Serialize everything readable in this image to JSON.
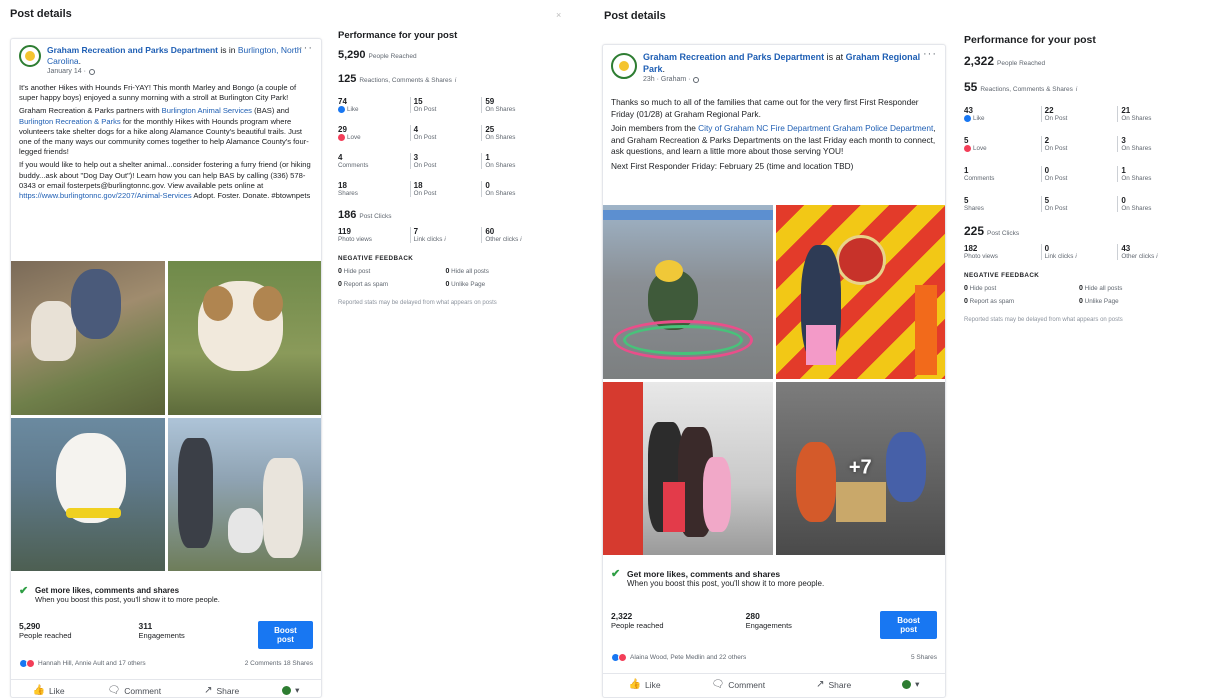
{
  "left": {
    "panel_title": "Post details",
    "close_label": "×",
    "post": {
      "page_name": "Graham Recreation and Parks Department",
      "is_in": " is in ",
      "location": "Burlington, North Carolina",
      "location_suffix": ".",
      "date": "January 14 ·",
      "more": "···",
      "p1": "It's another Hikes with Hounds Fri-YAY! This month Marley and Bongo (a couple of super happy boys) enjoyed a sunny morning with a stroll at Burlington City Park!",
      "p2_a": "Graham Recreation & Parks partners with ",
      "p2_link1": "Burlington Animal Services",
      "p2_b": " (BAS) and ",
      "p2_link2": "Burlington Recreation & Parks",
      "p2_c": " for the monthly Hikes with Hounds program where volunteers take shelter dogs for a hike along Alamance County's beautiful trails. Just one of the many ways our community comes together to help Alamance County's four-legged friends!",
      "p3_a": "If you would like to help out a shelter animal...consider fostering a furry friend (or hiking buddy...ask about \"Dog Day Out\")! Learn how you can help BAS by calling (336) 578-0343 or email fosterpets@burlingtonnc.gov. View available pets online at ",
      "p3_link": "https://www.burlingtonnc.gov/2207/Animal-Services",
      "p3_b": " Adopt. Foster. Donate. #btownpets",
      "boost_title": "Get more likes, comments and shares",
      "boost_sub": "When you boost this post, you'll show it to more people.",
      "reach_num": "5,290",
      "reach_lbl": "People reached",
      "eng_num": "311",
      "eng_lbl": "Engagements",
      "boost_btn": "Boost post",
      "reactors": "Hannah Hill, Annie Ault and 17 others",
      "social_right": "2 Comments  18 Shares",
      "like": "Like",
      "comment": "Comment",
      "share": "Share",
      "avatar_caret": "▾"
    },
    "perf": {
      "title": "Performance for your post",
      "reached_num": "5,290",
      "reached_lbl": "People Reached",
      "rcs_num": "125",
      "rcs_lbl": "Reactions, Comments & Shares",
      "rows": [
        {
          "a_num": "74",
          "a_lbl": "Like",
          "b_num": "15",
          "b_lbl": "On Post",
          "c_num": "59",
          "c_lbl": "On Shares"
        },
        {
          "a_num": "29",
          "a_lbl": "Love",
          "b_num": "4",
          "b_lbl": "On Post",
          "c_num": "25",
          "c_lbl": "On Shares"
        },
        {
          "a_num": "4",
          "a_lbl": "Comments",
          "b_num": "3",
          "b_lbl": "On Post",
          "c_num": "1",
          "c_lbl": "On Shares"
        },
        {
          "a_num": "18",
          "a_lbl": "Shares",
          "b_num": "18",
          "b_lbl": "On Post",
          "c_num": "0",
          "c_lbl": "On Shares"
        }
      ],
      "clicks_num": "186",
      "clicks_lbl": "Post Clicks",
      "clicks": {
        "a_num": "119",
        "a_lbl": "Photo views",
        "b_num": "7",
        "b_lbl": "Link clicks",
        "c_num": "60",
        "c_lbl": "Other clicks"
      },
      "neg_title": "NEGATIVE FEEDBACK",
      "neg": [
        {
          "num": "0",
          "lbl": "Hide post"
        },
        {
          "num": "0",
          "lbl": "Hide all posts"
        },
        {
          "num": "0",
          "lbl": "Report as spam"
        },
        {
          "num": "0",
          "lbl": "Unlike Page"
        }
      ],
      "note": "Reported stats may be delayed from what appears on posts"
    }
  },
  "right": {
    "panel_title": "Post details",
    "post": {
      "page_name": "Graham Recreation and Parks Department",
      "is_in": " is at ",
      "location": "Graham Regional Park",
      "location_suffix": ".",
      "date": "23h · Graham ·",
      "more": "···",
      "p1": "Thanks so much to all of the families that came out for the very first First Responder Friday (01/28) at Graham Regional Park.",
      "p2_a": "Join members from the ",
      "p2_link1": "City of Graham NC Fire Department",
      "p2_link2": "Graham Police Department",
      "p2_b": ", and Graham Recreation & Parks Departments on the last Friday each month to connect, ask questions, and learn a little more about those serving YOU!",
      "p3": "Next First Responder Friday: February 25 (time and location TBD)",
      "more_count": "+7",
      "boost_title": "Get more likes, comments and shares",
      "boost_sub": "When you boost this post, you'll show it to more people.",
      "reach_num": "2,322",
      "reach_lbl": "People reached",
      "eng_num": "280",
      "eng_lbl": "Engagements",
      "boost_btn": "Boost post",
      "reactors": "Alaina Wood, Pete Medlin and 22 others",
      "social_right": "5 Shares",
      "like": "Like",
      "comment": "Comment",
      "share": "Share",
      "avatar_caret": "▾"
    },
    "perf": {
      "title": "Performance for your post",
      "reached_num": "2,322",
      "reached_lbl": "People Reached",
      "rcs_num": "55",
      "rcs_lbl": "Reactions, Comments & Shares",
      "rows": [
        {
          "a_num": "43",
          "a_lbl": "Like",
          "b_num": "22",
          "b_lbl": "On Post",
          "c_num": "21",
          "c_lbl": "On Shares"
        },
        {
          "a_num": "5",
          "a_lbl": "Love",
          "b_num": "2",
          "b_lbl": "On Post",
          "c_num": "3",
          "c_lbl": "On Shares"
        },
        {
          "a_num": "1",
          "a_lbl": "Comments",
          "b_num": "0",
          "b_lbl": "On Post",
          "c_num": "1",
          "c_lbl": "On Shares"
        },
        {
          "a_num": "5",
          "a_lbl": "Shares",
          "b_num": "5",
          "b_lbl": "On Post",
          "c_num": "0",
          "c_lbl": "On Shares"
        }
      ],
      "clicks_num": "225",
      "clicks_lbl": "Post Clicks",
      "clicks": {
        "a_num": "182",
        "a_lbl": "Photo views",
        "b_num": "0",
        "b_lbl": "Link clicks",
        "c_num": "43",
        "c_lbl": "Other clicks"
      },
      "neg_title": "NEGATIVE FEEDBACK",
      "neg": [
        {
          "num": "0",
          "lbl": "Hide post"
        },
        {
          "num": "0",
          "lbl": "Hide all posts"
        },
        {
          "num": "0",
          "lbl": "Report as spam"
        },
        {
          "num": "0",
          "lbl": "Unlike Page"
        }
      ],
      "note": "Reported stats may be delayed from what appears on posts"
    }
  },
  "icons": {
    "info": "i",
    "check": "✔",
    "like": "👍",
    "comment": "🗨",
    "share": "↗"
  },
  "colors": {
    "accent": "#1877f2",
    "link": "#1f5fb4",
    "love": "#f33e58",
    "check": "#2e9e44"
  }
}
